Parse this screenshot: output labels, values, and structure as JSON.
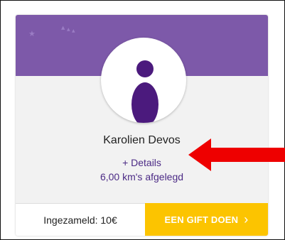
{
  "participant": {
    "name": "Karolien Devos",
    "details_link": "+ Details",
    "distance": "6,00 km's afgelegd"
  },
  "footer": {
    "collected_text": "Ingezameld: 10€",
    "donate_label": "EEN GIFT DOEN",
    "donate_chevron": "›"
  },
  "colors": {
    "banner": "#7d59a9",
    "accent_text": "#4b2a85",
    "donate_button": "#fcc400",
    "annotation_arrow": "#ee0000"
  },
  "icons": {
    "banner_decoration": "moon-stars-icon",
    "avatar": "person-silhouette-icon",
    "annotation": "red-arrow-icon"
  }
}
